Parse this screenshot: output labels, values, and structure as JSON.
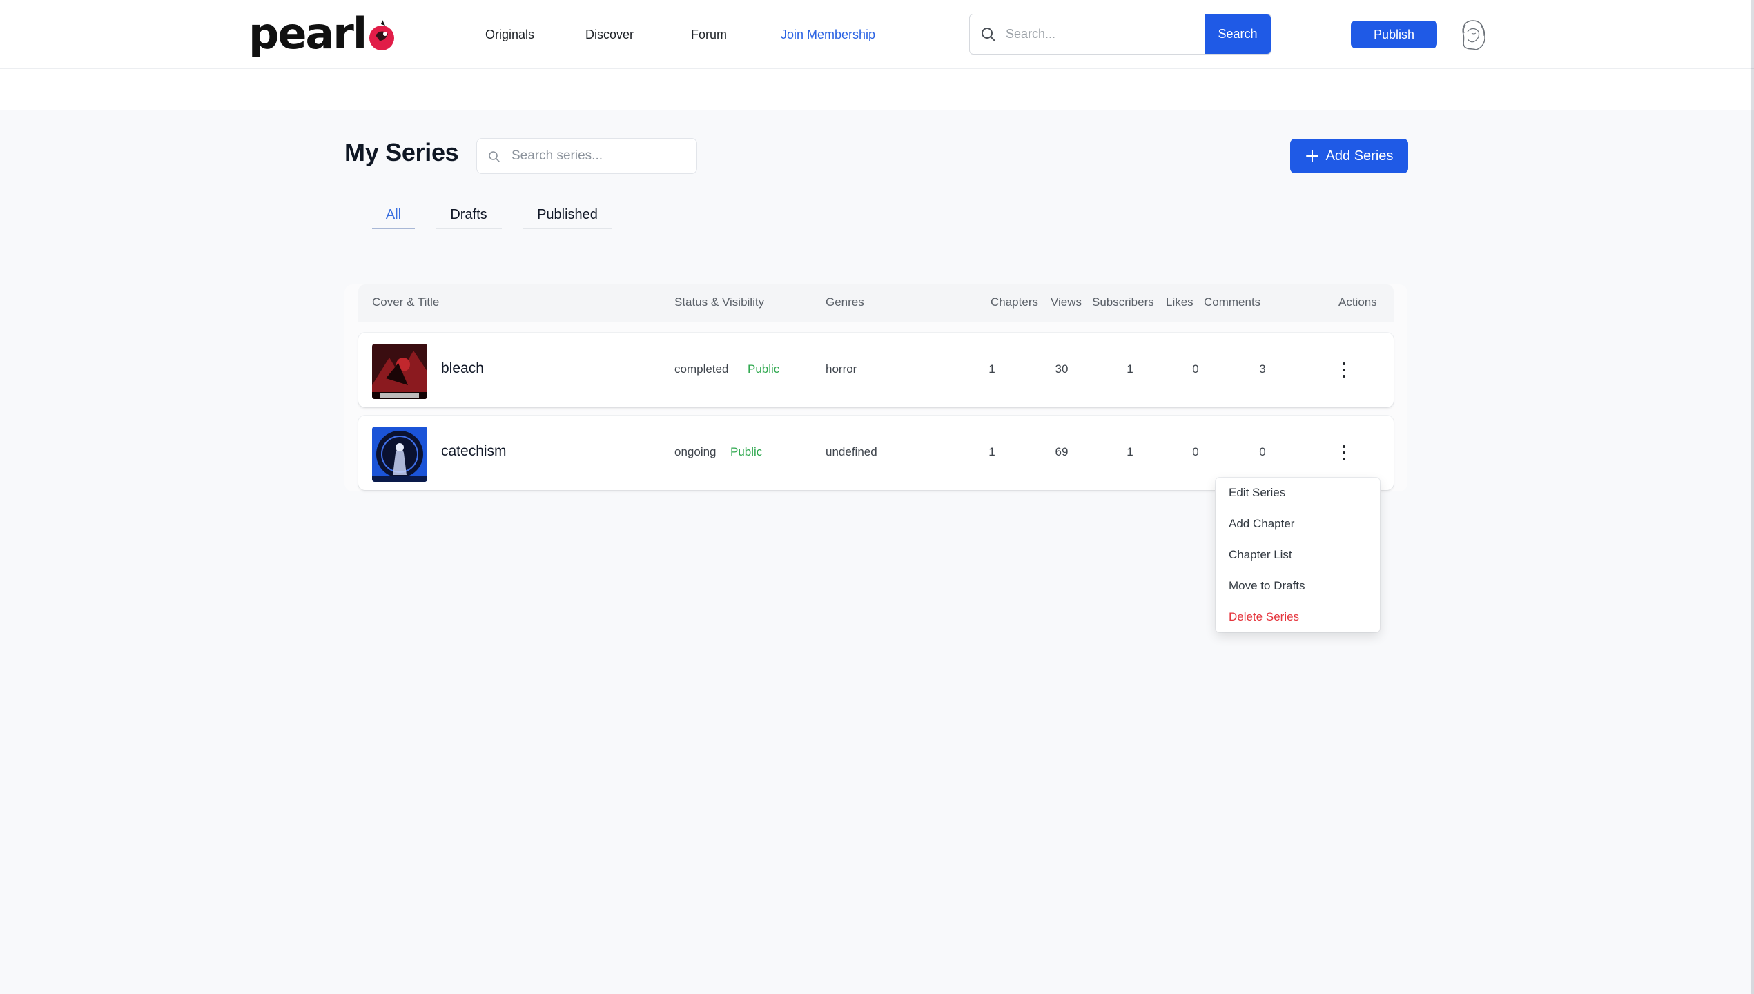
{
  "header": {
    "logo_text": "pearl",
    "nav": [
      "Originals",
      "Discover",
      "Forum",
      "Join Membership"
    ],
    "search_placeholder": "Search...",
    "search_button": "Search",
    "publish_button": "Publish",
    "accent_color": "#1f5ae6",
    "membership_color": "#2b63e3"
  },
  "page": {
    "title": "My Series",
    "search_placeholder": "Search series...",
    "add_button": "Add Series",
    "tabs": [
      "All",
      "Drafts",
      "Published"
    ],
    "active_tab": "All"
  },
  "table": {
    "columns": [
      "Cover & Title",
      "Status & Visibility",
      "Genres",
      "Chapters",
      "Views",
      "Subscribers",
      "Likes",
      "Comments",
      "Actions"
    ],
    "rows": [
      {
        "title": "bleach",
        "status": "completed",
        "visibility": "Public",
        "genre": "horror",
        "chapters": "1",
        "views": "30",
        "subscribers": "1",
        "likes": "0",
        "comments": "3"
      },
      {
        "title": "catechism",
        "status": "ongoing",
        "visibility": "Public",
        "genre": "undefined",
        "chapters": "1",
        "views": "69",
        "subscribers": "1",
        "likes": "0",
        "comments": "0"
      }
    ]
  },
  "actions_menu": {
    "items": [
      "Edit Series",
      "Add Chapter",
      "Chapter List",
      "Move to Drafts",
      "Delete Series"
    ],
    "danger_color": "#e5353d"
  },
  "icons": {
    "header_search": "search-icon",
    "series_search": "search-icon",
    "add": "plus-icon",
    "avatar": "user-avatar-icon",
    "actions": "more-vertical-icon"
  }
}
